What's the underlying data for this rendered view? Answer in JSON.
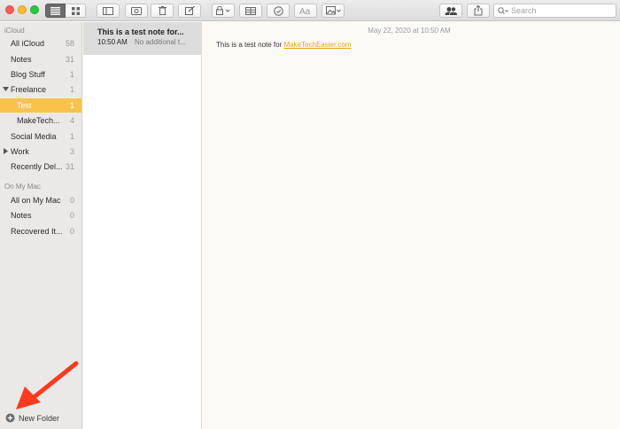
{
  "toolbar": {
    "search_placeholder": "Search"
  },
  "sidebar": {
    "icloud_header": "iCloud",
    "icloud_folders": [
      {
        "label": "All iCloud",
        "count": "58"
      },
      {
        "label": "Notes",
        "count": "31"
      },
      {
        "label": "Blog Stuff",
        "count": "1"
      },
      {
        "label": "Freelance",
        "count": "1"
      },
      {
        "label": "Test",
        "count": "1"
      },
      {
        "label": "MakeTech...",
        "count": "4"
      },
      {
        "label": "Social Media",
        "count": "1"
      },
      {
        "label": "Work",
        "count": "3"
      },
      {
        "label": "Recently Del...",
        "count": "31"
      }
    ],
    "mac_header": "On My Mac",
    "mac_folders": [
      {
        "label": "All on My Mac",
        "count": "0"
      },
      {
        "label": "Notes",
        "count": "0"
      },
      {
        "label": "Recovered It...",
        "count": "0"
      }
    ],
    "new_folder_label": "New Folder"
  },
  "notelist": {
    "notes": [
      {
        "title": "This is a test note for...",
        "time": "10:50 AM",
        "snippet": "No additional t..."
      }
    ]
  },
  "editor": {
    "date": "May 22, 2020 at 10:50 AM",
    "body_text": "This is a test note for ",
    "link_text": "MakeTechEasier.com"
  },
  "colors": {
    "accent": "#f9c24d",
    "link": "#e3a31c",
    "arrow": "#ff3b1f"
  }
}
